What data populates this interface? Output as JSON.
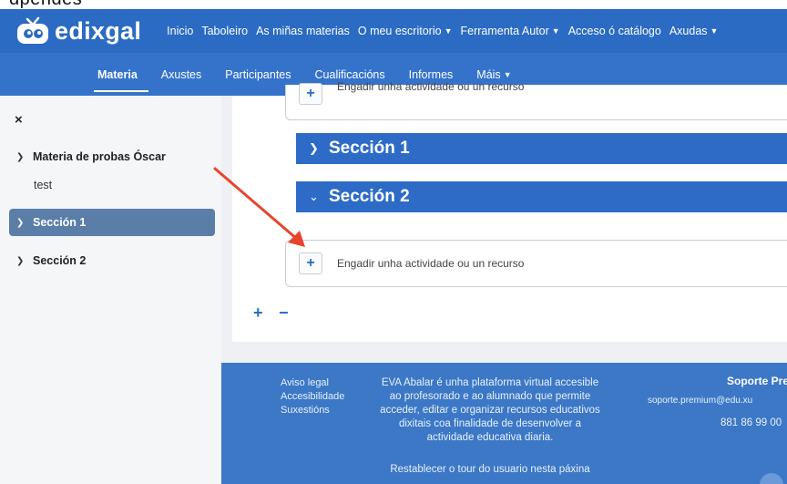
{
  "clipped_top_text": "dpendes",
  "logo": {
    "text": "edixgal"
  },
  "topnav": [
    {
      "label": "Inicio",
      "dropdown": false
    },
    {
      "label": "Taboleiro",
      "dropdown": false
    },
    {
      "label": "As miñas materias",
      "dropdown": false
    },
    {
      "label": "O meu escritorio",
      "dropdown": true
    },
    {
      "label": "Ferramenta Autor",
      "dropdown": true
    },
    {
      "label": "Acceso ó catálogo",
      "dropdown": false
    },
    {
      "label": "Axudas",
      "dropdown": true
    }
  ],
  "subnav": [
    {
      "label": "Materia",
      "active": true
    },
    {
      "label": "Axustes"
    },
    {
      "label": "Participantes"
    },
    {
      "label": "Cualificacións"
    },
    {
      "label": "Informes"
    },
    {
      "label": "Máis",
      "dropdown": true
    }
  ],
  "sidebar": {
    "close": "×",
    "course": "Materia de probas Óscar",
    "sub": "test",
    "section1": "Sección 1",
    "section2": "Sección 2"
  },
  "main": {
    "add_activity_label": "Engadir unha actividade ou un recurso",
    "section1_title": "Sección 1",
    "section2_title": "Sección 2",
    "plus": "+",
    "minus": "−"
  },
  "footer": {
    "links": [
      "Aviso legal",
      "Accesibilidade",
      "Suxestións"
    ],
    "description": [
      "EVA Abalar é unha plataforma virtual accesible",
      "ao profesorado e ao alumnado que permite",
      "acceder, editar e organizar recursos educativos",
      "dixitais coa finalidade de desenvolver a",
      "actividade educativa diaria."
    ],
    "tour": "Restablecer o tour do usuario nesta páxina",
    "support_title": "Soporte Pre",
    "support_email": "soporte.premium@edu.xu",
    "support_phone": "881 86 99 00"
  },
  "colors": {
    "brand": "#2b6bc4",
    "section_bar": "#2d6bc7",
    "sidebar_active": "#5b7ea9",
    "annotation_arrow": "#e8442e"
  },
  "icons": {
    "close": "close-icon",
    "expand": "chevron-down-icon",
    "collapsed": "chevron-right-icon",
    "add": "plus-icon"
  }
}
